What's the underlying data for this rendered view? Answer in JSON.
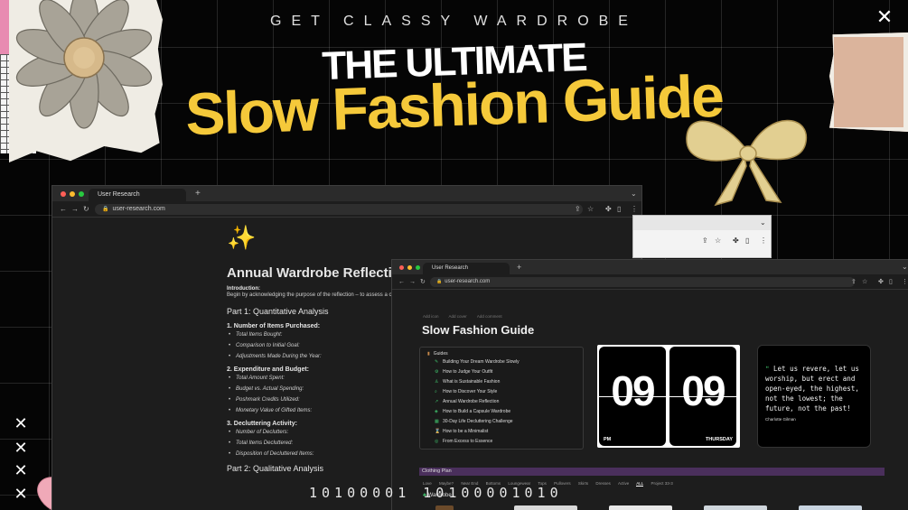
{
  "header": {
    "brand": "GET CLASSY WARDROBE",
    "title_line1": "THE ULTIMATE",
    "title_line2": "Slow Fashion Guide"
  },
  "binary_text": "10100001 10100001010",
  "icons": {
    "close": "✕",
    "sparkle_globe": "✨"
  },
  "colors": {
    "accent_yellow": "#f5c93a",
    "accent_green": "#3fbf6a",
    "plan_bar": "#4a2f5c"
  },
  "window_reflection": {
    "tab_title": "User Research",
    "url": "user-research.com",
    "title": "Annual Wardrobe Reflectio",
    "intro_label": "Introduction:",
    "intro_text": "Begin by acknowledging the purpose of the reflection – to assess a choices over the past year.",
    "part1": "Part 1: Quantitative Analysis",
    "sections": [
      {
        "heading": "1. Number of Items Purchased:",
        "items": [
          "Total Items Bought:",
          "Comparison to Initial Goal:",
          "Adjustments Made During the Year:"
        ]
      },
      {
        "heading": "2. Expenditure and Budget:",
        "items": [
          "Total Amount Spent:",
          "Budget vs. Actual Spending:",
          "Poshmark Credits Utilized:",
          "Monetary Value of Gifted Items:"
        ]
      },
      {
        "heading": "3. Decluttering Activity:",
        "items": [
          "Number of Declutters:",
          "Total Items Decluttered:",
          "Disposition of Decluttered Items:"
        ]
      }
    ],
    "part2": "Part 2: Qualitative Analysis"
  },
  "window_guide": {
    "tab_title": "User Research",
    "url": "user-research.com",
    "toolbar": {
      "add_icon": "Add icon",
      "add_cover": "Add cover",
      "add_comment": "Add comment"
    },
    "title": "Slow Fashion Guide",
    "guides_heading": "Guides",
    "guides": [
      "Building Your Dream Wardrobe Slowly",
      "How to Judge Your Outfit",
      "What is Sustainable Fashion",
      "How to Discover Your Style",
      "Annual Wardrobe Reflection",
      "How to Build a Capsule Wardrobe",
      "30-Day Life Decluttering Challenge",
      "How to be a Minimalist",
      "From Excess to Essence"
    ],
    "clock": {
      "hour": "09",
      "minute": "09",
      "period": "PM",
      "day": "THURSDAY"
    },
    "quote": {
      "text": "Let us revere, let us worship, but erect and open-eyed, the highest, not the lowest; the future, not the past!",
      "author": "Charlotte Gilman"
    },
    "clothing_plan": "Clothing Plan",
    "views": [
      "Love",
      "Maybe?",
      "Near End",
      "Bottoms",
      "Loungewear",
      "Tops",
      "Pullovers",
      "Skirts",
      "Dresses",
      "Active",
      "ALL",
      "Project 33-3"
    ],
    "active_view": "ALL",
    "wardrobe_label": "Wardrobe"
  }
}
